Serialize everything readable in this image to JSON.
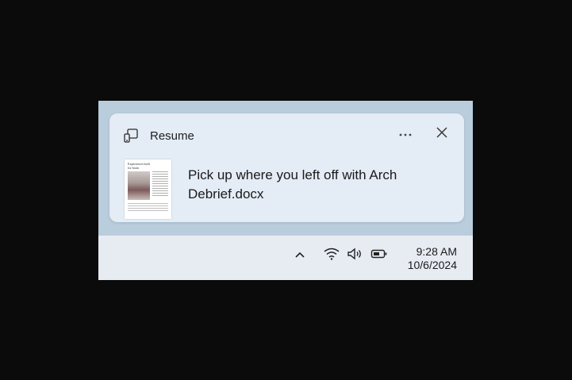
{
  "notification": {
    "app_name": "Resume",
    "app_icon": "phone-pc-link-icon",
    "more_icon": "more-ellipsis-icon",
    "close_icon": "close-icon",
    "message": "Pick up where you left off with Arch Debrief.docx",
    "thumbnail_title": "Experiences built for brain",
    "thumbnail_icon": "document-thumbnail"
  },
  "taskbar": {
    "tray_icons": [
      "chevron-up-icon",
      "wifi-icon",
      "volume-icon",
      "battery-icon"
    ],
    "time": "9:28 AM",
    "date": "10/6/2024"
  },
  "colors": {
    "background": "#0b0b0b",
    "screen_bg": "#b9cddd",
    "toast_bg": "#e4ecf5",
    "taskbar_bg": "#e7ecf3"
  }
}
